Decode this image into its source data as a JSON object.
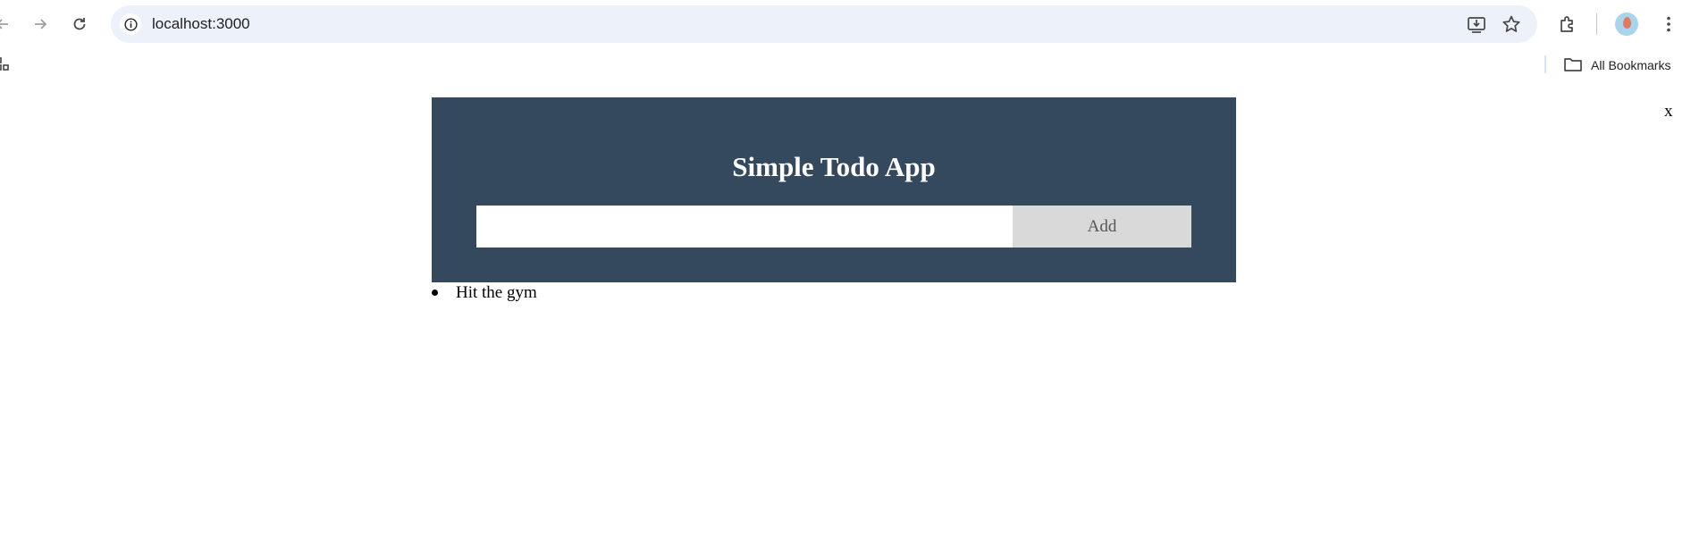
{
  "browser": {
    "url": "localhost:3000",
    "bookmarks_label": "All Bookmarks",
    "icons": {
      "back": "arrow-left-icon",
      "forward": "arrow-right-icon",
      "reload": "reload-icon",
      "site_info": "info-icon",
      "install": "install-app-icon",
      "bookmark": "star-icon",
      "extensions": "puzzle-icon",
      "profile": "avatar",
      "menu": "kebab-menu-icon",
      "apps": "apps-grid-icon",
      "folder": "folder-icon"
    }
  },
  "app": {
    "close_label": "x",
    "title": "Simple Todo App",
    "input_value": "",
    "add_label": "Add",
    "todos": [
      {
        "text": "Hit the gym"
      }
    ]
  },
  "colors": {
    "header_bg": "#34495e",
    "header_text": "#ffffff",
    "button_bg": "#d9d9d9",
    "omnibox_bg": "#edf2fa"
  }
}
